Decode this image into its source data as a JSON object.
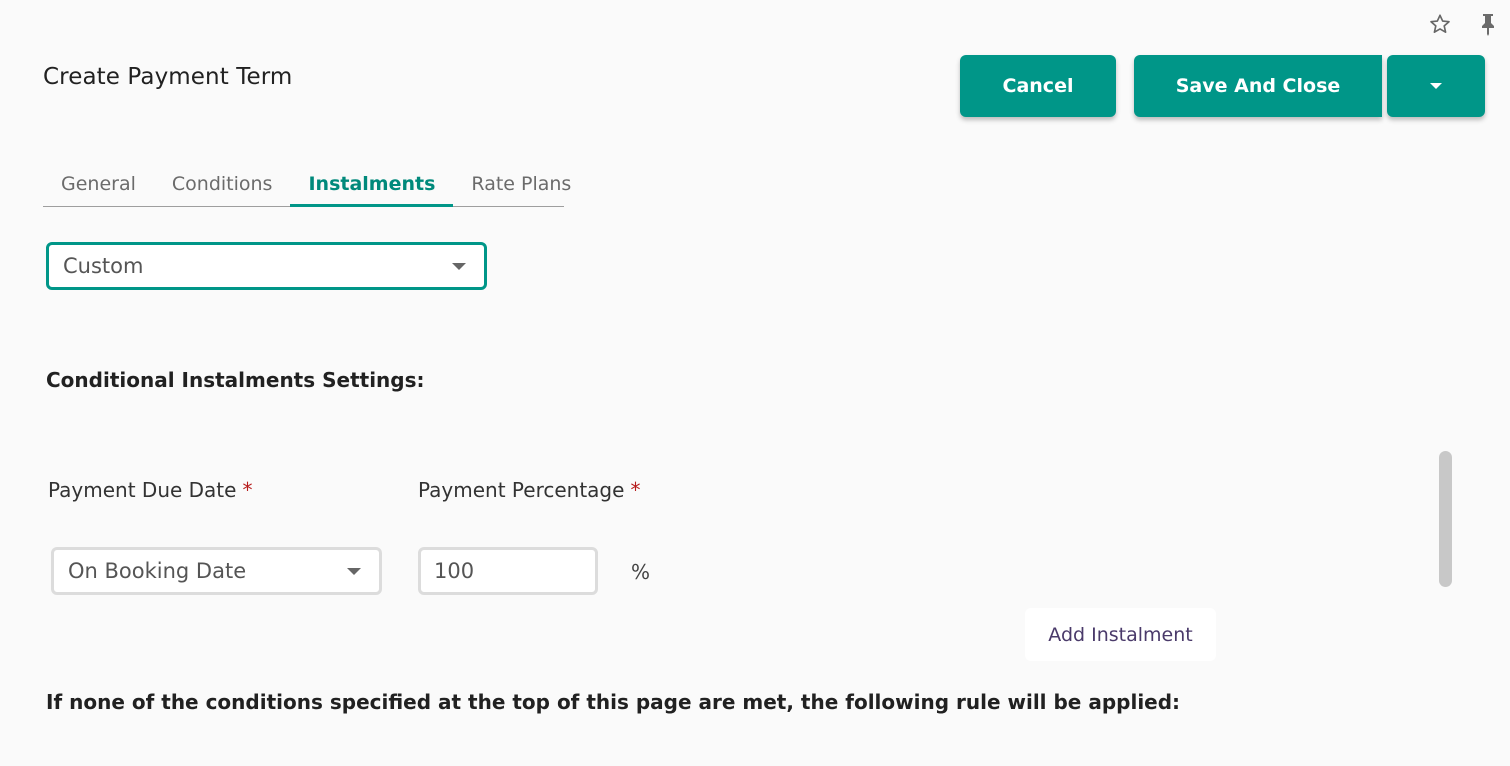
{
  "browser": {
    "icons": [
      "star-icon",
      "pin-icon"
    ]
  },
  "header": {
    "title": "Create Payment Term",
    "cancel_label": "Cancel",
    "save_label": "Save And Close",
    "more_icon": "caret-down-icon"
  },
  "tabs": [
    {
      "label": "General",
      "active": false
    },
    {
      "label": "Conditions",
      "active": false
    },
    {
      "label": "Instalments",
      "active": true
    },
    {
      "label": "Rate Plans",
      "active": false
    }
  ],
  "instalment_mode": {
    "selected": "Custom"
  },
  "conditional_section": {
    "heading": "Conditional Instalments Settings:",
    "due_date_label": "Payment Due Date",
    "percentage_label": "Payment Percentage",
    "required_marker": "*",
    "rows": [
      {
        "due_date": "On Booking Date",
        "percentage": "100",
        "unit": "%"
      }
    ],
    "add_button_label": "Add Instalment"
  },
  "default_rule": {
    "heading": "If none of the conditions specified at the top of this page are met, the following rule will be applied:"
  },
  "colors": {
    "accent": "#009688",
    "required": "#b71c1c",
    "background": "#fafafa"
  }
}
